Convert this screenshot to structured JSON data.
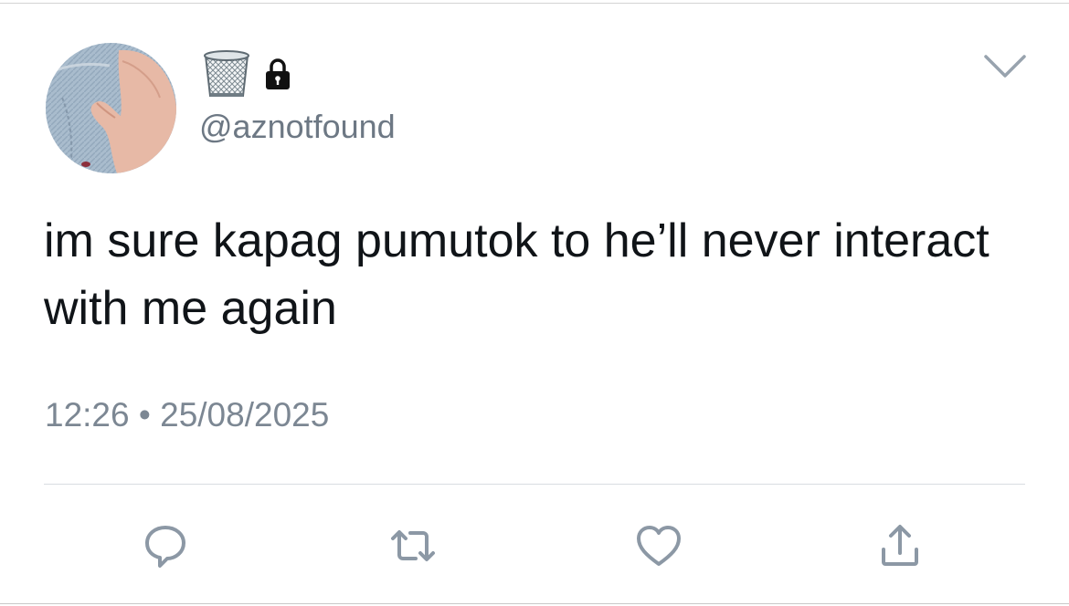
{
  "tweet": {
    "handle": "@aznotfound",
    "text": "im sure kapag pumutok to he’ll never interact with me again",
    "time": "12:26",
    "separator": "•",
    "date": "25/08/2025",
    "name_icons": [
      "wastebasket-icon",
      "lock-icon"
    ]
  },
  "actions": [
    {
      "name": "reply",
      "icon": "reply-icon"
    },
    {
      "name": "retweet",
      "icon": "retweet-icon"
    },
    {
      "name": "like",
      "icon": "heart-icon"
    },
    {
      "name": "share",
      "icon": "share-icon"
    }
  ],
  "colors": {
    "text": "#101418",
    "secondary": "#6d7884",
    "icon": "#8c98a5",
    "divider": "#d9dde1"
  }
}
